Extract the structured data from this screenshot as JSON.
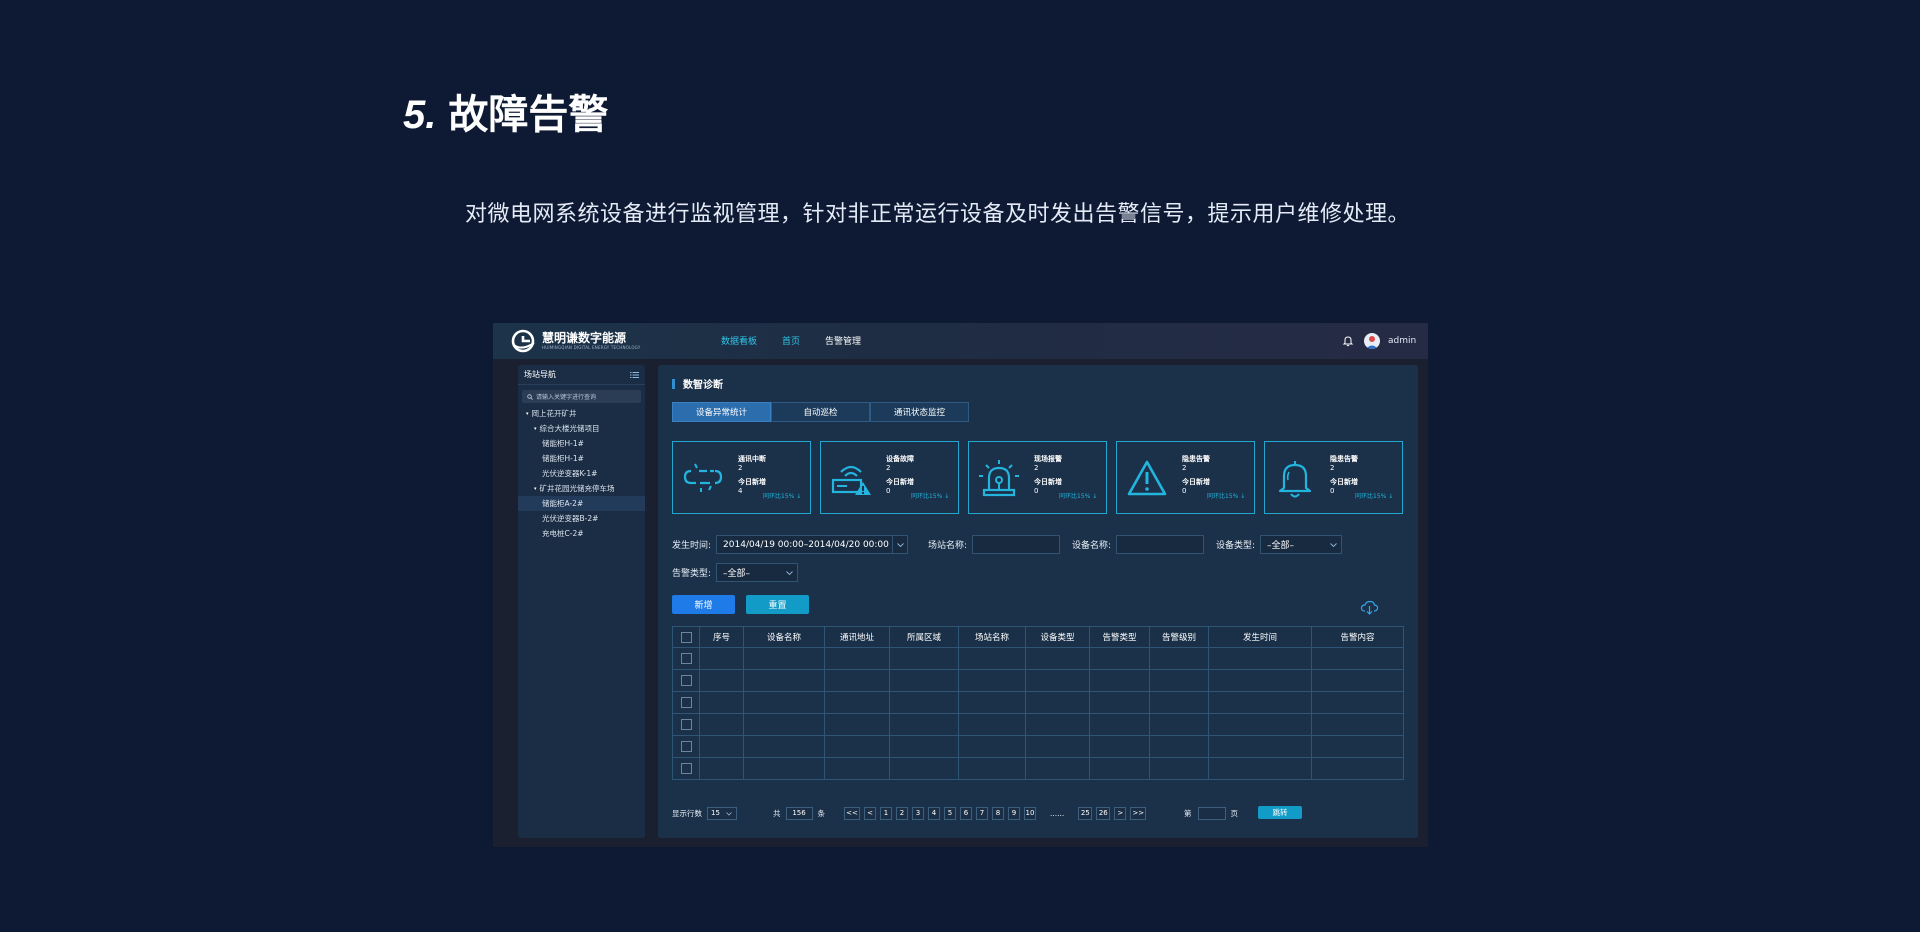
{
  "heading": {
    "number": "5.",
    "title": "故障告警"
  },
  "description": "对微电网系统设备进行监视管理，针对非正常运行设备及时发出告警信号，提示用户维修处理。",
  "app": {
    "logo": {
      "name": "慧明谦数字能源",
      "subtitle": "HUIMINGQIAN DIGITAL ENERGY TECHNOLOGY"
    },
    "nav": [
      "数据看板",
      "首页",
      "告警管理"
    ],
    "user": "admin",
    "sidebar": {
      "title": "场站导航",
      "search_placeholder": "请输入关键字进行查询",
      "tree": [
        {
          "label": "岡上花开矿井",
          "level": 0,
          "caret": true
        },
        {
          "label": "综合大楼光储项目",
          "level": 1,
          "caret": true
        },
        {
          "label": "储能柜H-1#",
          "level": 2
        },
        {
          "label": "储能柜H-1#",
          "level": 2
        },
        {
          "label": "光伏逆变器K-1#",
          "level": 2
        },
        {
          "label": "矿井花园光储充停车场",
          "level": 1,
          "caret": true
        },
        {
          "label": "储能柜A-2#",
          "level": 2,
          "selected": true
        },
        {
          "label": "光伏逆变器B-2#",
          "level": 2
        },
        {
          "label": "充电桩C-2#",
          "level": 2
        }
      ]
    },
    "main": {
      "title": "数智诊断",
      "tabs": [
        "设备异常统计",
        "自动巡检",
        "通讯状态监控"
      ],
      "cards": [
        {
          "icon": "link-broken-icon",
          "title": "通讯中断",
          "count": "2",
          "new_label": "今日新增",
          "new_count": "4",
          "ratio": "同环比15% ↓"
        },
        {
          "icon": "device-fault-icon",
          "title": "设备故障",
          "count": "2",
          "new_label": "今日新增",
          "new_count": "0",
          "ratio": "同环比15% ↓"
        },
        {
          "icon": "siren-icon",
          "title": "现场报警",
          "count": "2",
          "new_label": "今日新增",
          "new_count": "0",
          "ratio": "同环比15% ↓"
        },
        {
          "icon": "warning-icon",
          "title": "隐患告警",
          "count": "2",
          "new_label": "今日新增",
          "new_count": "0",
          "ratio": "同环比15% ↓"
        },
        {
          "icon": "bell-alert-icon",
          "title": "隐患告警",
          "count": "2",
          "new_label": "今日新增",
          "new_count": "0",
          "ratio": "同环比15% ↓"
        }
      ],
      "filters": {
        "time_label": "发生时间:",
        "time_value": "2014/04/19 00:00–2014/04/20 00:00",
        "site_label": "场站名称:",
        "device_label": "设备名称:",
        "device_type_label": "设备类型:",
        "device_type_value": "–全部–",
        "alarm_type_label": "告警类型:",
        "alarm_type_value": "–全部–"
      },
      "buttons": {
        "add": "新增",
        "reset": "重置"
      },
      "table": {
        "columns": [
          "序号",
          "设备名称",
          "通讯地址",
          "所属区域",
          "场站名称",
          "设备类型",
          "告警类型",
          "告警级别",
          "发生时间",
          "告警内容"
        ],
        "empty_rows": 6
      },
      "pager": {
        "rows_label": "显示行数",
        "rows_value": "15",
        "total_prefix": "共",
        "total": "156",
        "total_suffix": "条",
        "first": "<<",
        "prev": "<",
        "pages": [
          "1",
          "2",
          "3",
          "4",
          "5",
          "6",
          "7",
          "8",
          "9",
          "10"
        ],
        "ellipsis": "......",
        "tail_pages": [
          "25",
          "26"
        ],
        "next": ">",
        "last": ">>",
        "goto_prefix": "第",
        "goto_suffix": "页",
        "jump": "跳转"
      }
    }
  }
}
